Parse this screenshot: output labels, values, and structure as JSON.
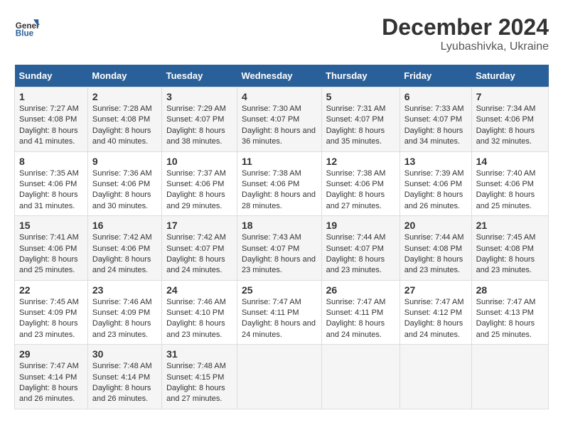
{
  "header": {
    "logo_line1": "General",
    "logo_line2": "Blue",
    "title": "December 2024",
    "subtitle": "Lyubashivka, Ukraine"
  },
  "days_of_week": [
    "Sunday",
    "Monday",
    "Tuesday",
    "Wednesday",
    "Thursday",
    "Friday",
    "Saturday"
  ],
  "weeks": [
    [
      {
        "day": 1,
        "sunrise": "7:27 AM",
        "sunset": "4:08 PM",
        "daylight": "8 hours and 41 minutes."
      },
      {
        "day": 2,
        "sunrise": "7:28 AM",
        "sunset": "4:08 PM",
        "daylight": "8 hours and 40 minutes."
      },
      {
        "day": 3,
        "sunrise": "7:29 AM",
        "sunset": "4:07 PM",
        "daylight": "8 hours and 38 minutes."
      },
      {
        "day": 4,
        "sunrise": "7:30 AM",
        "sunset": "4:07 PM",
        "daylight": "8 hours and 36 minutes."
      },
      {
        "day": 5,
        "sunrise": "7:31 AM",
        "sunset": "4:07 PM",
        "daylight": "8 hours and 35 minutes."
      },
      {
        "day": 6,
        "sunrise": "7:33 AM",
        "sunset": "4:07 PM",
        "daylight": "8 hours and 34 minutes."
      },
      {
        "day": 7,
        "sunrise": "7:34 AM",
        "sunset": "4:06 PM",
        "daylight": "8 hours and 32 minutes."
      }
    ],
    [
      {
        "day": 8,
        "sunrise": "7:35 AM",
        "sunset": "4:06 PM",
        "daylight": "8 hours and 31 minutes."
      },
      {
        "day": 9,
        "sunrise": "7:36 AM",
        "sunset": "4:06 PM",
        "daylight": "8 hours and 30 minutes."
      },
      {
        "day": 10,
        "sunrise": "7:37 AM",
        "sunset": "4:06 PM",
        "daylight": "8 hours and 29 minutes."
      },
      {
        "day": 11,
        "sunrise": "7:38 AM",
        "sunset": "4:06 PM",
        "daylight": "8 hours and 28 minutes."
      },
      {
        "day": 12,
        "sunrise": "7:38 AM",
        "sunset": "4:06 PM",
        "daylight": "8 hours and 27 minutes."
      },
      {
        "day": 13,
        "sunrise": "7:39 AM",
        "sunset": "4:06 PM",
        "daylight": "8 hours and 26 minutes."
      },
      {
        "day": 14,
        "sunrise": "7:40 AM",
        "sunset": "4:06 PM",
        "daylight": "8 hours and 25 minutes."
      }
    ],
    [
      {
        "day": 15,
        "sunrise": "7:41 AM",
        "sunset": "4:06 PM",
        "daylight": "8 hours and 25 minutes."
      },
      {
        "day": 16,
        "sunrise": "7:42 AM",
        "sunset": "4:06 PM",
        "daylight": "8 hours and 24 minutes."
      },
      {
        "day": 17,
        "sunrise": "7:42 AM",
        "sunset": "4:07 PM",
        "daylight": "8 hours and 24 minutes."
      },
      {
        "day": 18,
        "sunrise": "7:43 AM",
        "sunset": "4:07 PM",
        "daylight": "8 hours and 23 minutes."
      },
      {
        "day": 19,
        "sunrise": "7:44 AM",
        "sunset": "4:07 PM",
        "daylight": "8 hours and 23 minutes."
      },
      {
        "day": 20,
        "sunrise": "7:44 AM",
        "sunset": "4:08 PM",
        "daylight": "8 hours and 23 minutes."
      },
      {
        "day": 21,
        "sunrise": "7:45 AM",
        "sunset": "4:08 PM",
        "daylight": "8 hours and 23 minutes."
      }
    ],
    [
      {
        "day": 22,
        "sunrise": "7:45 AM",
        "sunset": "4:09 PM",
        "daylight": "8 hours and 23 minutes."
      },
      {
        "day": 23,
        "sunrise": "7:46 AM",
        "sunset": "4:09 PM",
        "daylight": "8 hours and 23 minutes."
      },
      {
        "day": 24,
        "sunrise": "7:46 AM",
        "sunset": "4:10 PM",
        "daylight": "8 hours and 23 minutes."
      },
      {
        "day": 25,
        "sunrise": "7:47 AM",
        "sunset": "4:11 PM",
        "daylight": "8 hours and 24 minutes."
      },
      {
        "day": 26,
        "sunrise": "7:47 AM",
        "sunset": "4:11 PM",
        "daylight": "8 hours and 24 minutes."
      },
      {
        "day": 27,
        "sunrise": "7:47 AM",
        "sunset": "4:12 PM",
        "daylight": "8 hours and 24 minutes."
      },
      {
        "day": 28,
        "sunrise": "7:47 AM",
        "sunset": "4:13 PM",
        "daylight": "8 hours and 25 minutes."
      }
    ],
    [
      {
        "day": 29,
        "sunrise": "7:47 AM",
        "sunset": "4:14 PM",
        "daylight": "8 hours and 26 minutes."
      },
      {
        "day": 30,
        "sunrise": "7:48 AM",
        "sunset": "4:14 PM",
        "daylight": "8 hours and 26 minutes."
      },
      {
        "day": 31,
        "sunrise": "7:48 AM",
        "sunset": "4:15 PM",
        "daylight": "8 hours and 27 minutes."
      },
      null,
      null,
      null,
      null
    ]
  ]
}
